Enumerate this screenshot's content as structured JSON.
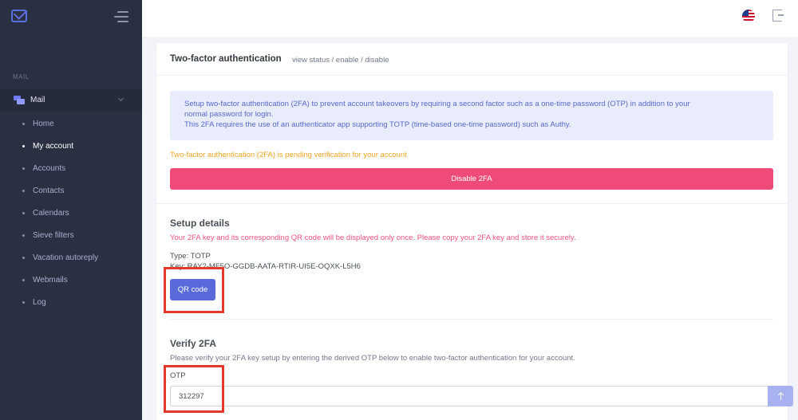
{
  "sidebar": {
    "section_label": "MAIL",
    "group_label": "Mail",
    "items": [
      {
        "label": "Home"
      },
      {
        "label": "My account"
      },
      {
        "label": "Accounts"
      },
      {
        "label": "Contacts"
      },
      {
        "label": "Calendars"
      },
      {
        "label": "Sieve filters"
      },
      {
        "label": "Vacation autoreply"
      },
      {
        "label": "Webmails"
      },
      {
        "label": "Log"
      }
    ],
    "active_item": "My account"
  },
  "topbar": {
    "language_icon": "us-flag-icon",
    "logout_icon": "logout-icon"
  },
  "card": {
    "title": "Two-factor authentication",
    "subtitle": "view status / enable / disable",
    "info": {
      "line1": "Setup two-factor authentication (2FA) to prevent account takeovers by requiring a second factor such as a one-time password (OTP) in addition to your",
      "line2": "normal password for login.",
      "line3": "This 2FA requires the use of an authenticator app supporting TOTP (time-based one-time password) such as Authy."
    },
    "pending_text": "Two-factor authentication (2FA) is pending verification for your account",
    "disable_label": "Disable 2FA",
    "setup": {
      "title": "Setup details",
      "warning": "Your 2FA key and its corresponding QR code will be displayed only once. Please copy your 2FA key and store it securely.",
      "type_line": "Type: TOTP",
      "key_line": "Key: RAY2-MF5O-GGDB-AATA-RTIR-UI5E-OQXK-L5H6",
      "qr_label": "QR code"
    },
    "verify": {
      "title": "Verify 2FA",
      "description": "Please verify your 2FA key setup by entering the derived OTP below to enable two-factor authentication for your account.",
      "otp_label": "OTP",
      "otp_value": "312297"
    }
  },
  "colors": {
    "sidebar_bg": "#2a3042",
    "accent": "#5b6adb",
    "danger": "#ef4b79",
    "warning": "#f1a524",
    "annotation": "#e23b2e"
  }
}
